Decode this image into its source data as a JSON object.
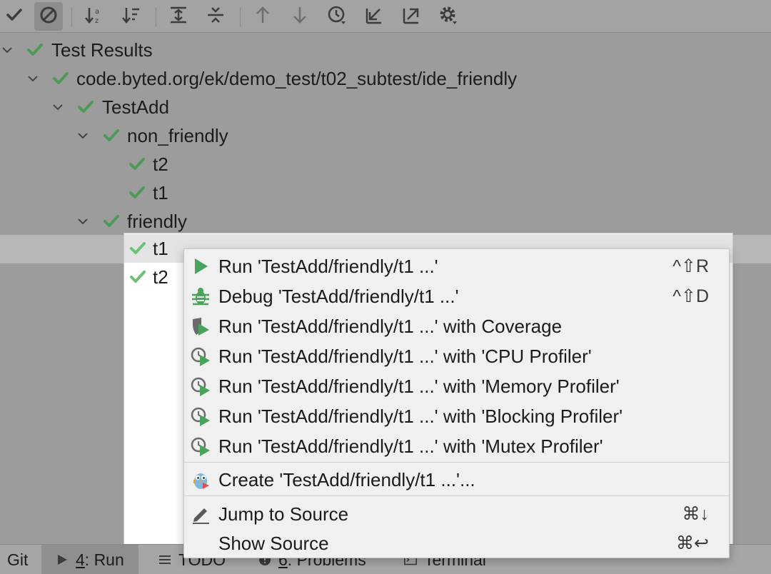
{
  "toolbar": {
    "icons": [
      "checkmark-icon",
      "cancel-icon",
      "sort-alpha-icon",
      "sort-duration-icon",
      "expand-all-icon",
      "collapse-all-icon",
      "arrow-up-icon",
      "arrow-down-icon",
      "history-icon",
      "import-icon",
      "export-icon",
      "gear-icon"
    ]
  },
  "tree": {
    "root": "Test Results",
    "package": "code.byted.org/ek/demo_test/t02_subtest/ide_friendly",
    "suite": "TestAdd",
    "group1": "non_friendly",
    "group1_t2": "t2",
    "group1_t1": "t1",
    "group2": "friendly",
    "group2_t1": "t1",
    "group2_t2": "t2"
  },
  "menu": {
    "run": {
      "label": "Run 'TestAdd/friendly/t1 ...'",
      "shortcut": "^⇧R"
    },
    "debug": {
      "label": "Debug 'TestAdd/friendly/t1 ...'",
      "shortcut": "^⇧D"
    },
    "coverage": {
      "label": "Run 'TestAdd/friendly/t1 ...' with Coverage"
    },
    "cpu": {
      "label": "Run 'TestAdd/friendly/t1 ...' with 'CPU Profiler'"
    },
    "memory": {
      "label": "Run 'TestAdd/friendly/t1 ...' with 'Memory Profiler'"
    },
    "blocking": {
      "label": "Run 'TestAdd/friendly/t1 ...' with 'Blocking Profiler'"
    },
    "mutex": {
      "label": "Run 'TestAdd/friendly/t1 ...' with 'Mutex Profiler'"
    },
    "create": {
      "label": "Create 'TestAdd/friendly/t1 ...'..."
    },
    "jump": {
      "label": "Jump to Source",
      "shortcut": "⌘↓"
    },
    "show": {
      "label": "Show Source",
      "shortcut": "⌘↩"
    }
  },
  "statusbar": {
    "git": "Git",
    "run_number": "4",
    "run_label": ": Run",
    "todo": "TODO",
    "problems_number": "6",
    "problems_label": ": Problems",
    "terminal": "Terminal"
  },
  "colors": {
    "check_green": "#4e9a57",
    "run_green": "#4aa35a",
    "toolbar_bg": "#a3a3a3",
    "menu_bg": "#f0f0f0"
  }
}
